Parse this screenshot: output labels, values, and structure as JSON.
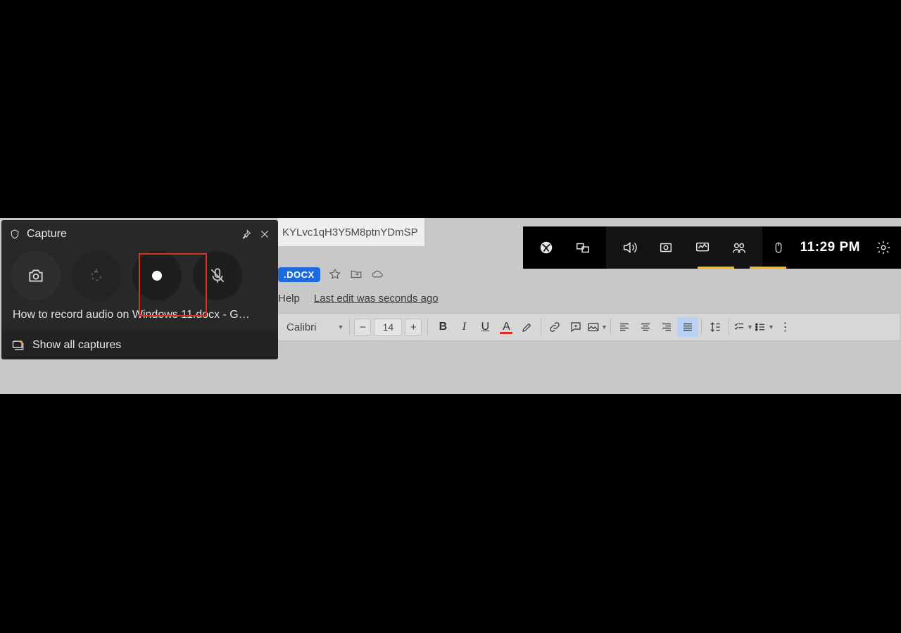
{
  "capture": {
    "title": "Capture",
    "target_window": "How to record audio on Windows 11.docx - G…",
    "show_all": "Show all captures"
  },
  "gamebar": {
    "time": "11:29 PM"
  },
  "docs": {
    "url_fragment": "KYLvc1qH3Y5M8ptnYDmSP",
    "badge": ".DOCX",
    "help_menu": "Help",
    "last_edit": "Last edit was seconds ago",
    "font": "Calibri",
    "font_size": "14"
  }
}
